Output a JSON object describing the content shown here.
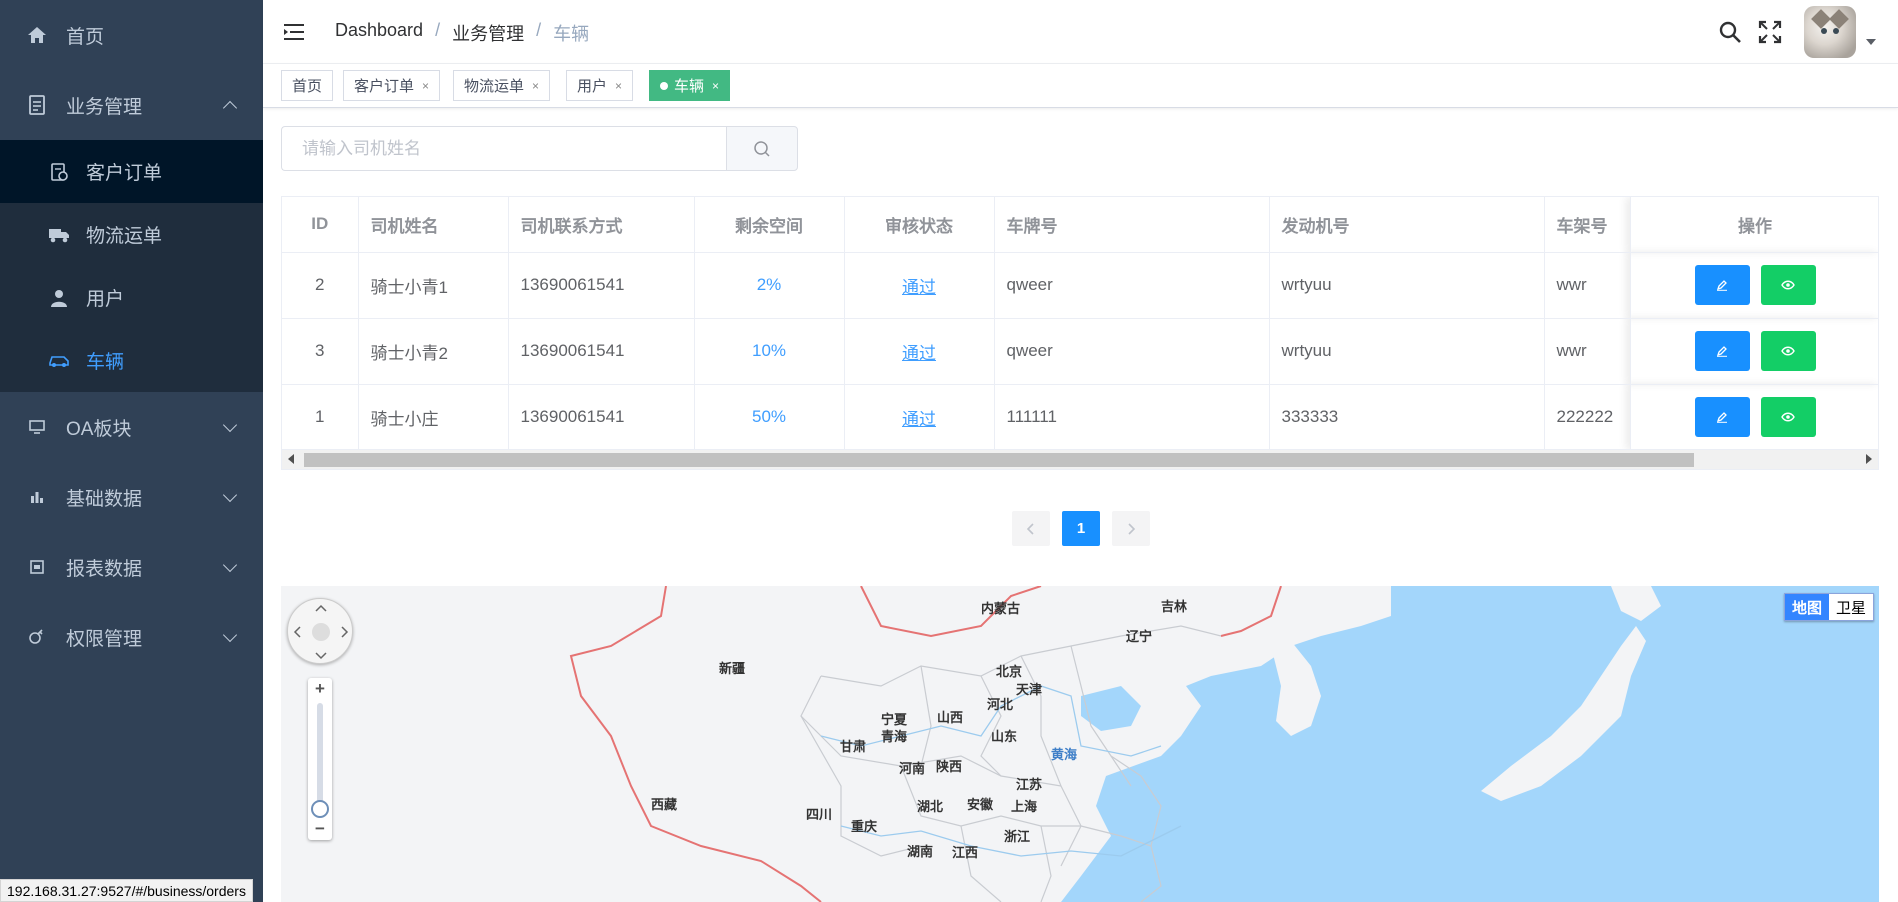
{
  "sidebar": {
    "home": "首页",
    "business": "业务管理",
    "sub": [
      "客户订单",
      "物流运单",
      "用户",
      "车辆"
    ],
    "oa": "OA板块",
    "basic": "基础数据",
    "report": "报表数据",
    "permission": "权限管理"
  },
  "navbar": {
    "breadcrumb": [
      "Dashboard",
      "业务管理",
      "车辆"
    ],
    "separator": "/"
  },
  "tags": [
    "首页",
    "客户订单",
    "物流运单",
    "用户",
    "车辆"
  ],
  "tag_close": "×",
  "search": {
    "placeholder": "请输入司机姓名"
  },
  "table": {
    "headers": [
      "ID",
      "司机姓名",
      "司机联系方式",
      "剩余空间",
      "审核状态",
      "车牌号",
      "发动机号",
      "车架号",
      "操作"
    ],
    "rows": [
      [
        "2",
        "骑士小青1",
        "13690061541",
        "2%",
        "通过",
        "qweer",
        "wrtyuu",
        "wwr"
      ],
      [
        "3",
        "骑士小青2",
        "13690061541",
        "10%",
        "通过",
        "qweer",
        "wrtyuu",
        "wwr"
      ],
      [
        "1",
        "骑士小庄",
        "13690061541",
        "50%",
        "通过",
        "111111",
        "333333",
        "222222"
      ]
    ]
  },
  "pagination": {
    "current": "1"
  },
  "map": {
    "types": [
      "地图",
      "卫星"
    ],
    "zoom_in": "+",
    "zoom_out": "−",
    "labels": [
      "内蒙古",
      "吉林",
      "辽宁",
      "新疆",
      "北京",
      "天津",
      "河北",
      "宁夏",
      "山西",
      "青海",
      "甘肃",
      "山东",
      "黄海",
      "陕西",
      "河南",
      "江苏",
      "西藏",
      "四川",
      "湖北",
      "安徽",
      "上海",
      "重庆",
      "浙江",
      "湖南",
      "江西"
    ]
  },
  "statusbar": "192.168.31.27:9527/#/business/orders",
  "colors": {
    "sidebar_bg": "#304156",
    "active_blue": "#409eff",
    "tag_green": "#42b983",
    "edit_btn": "#1890ff",
    "view_btn": "#13ce66"
  }
}
